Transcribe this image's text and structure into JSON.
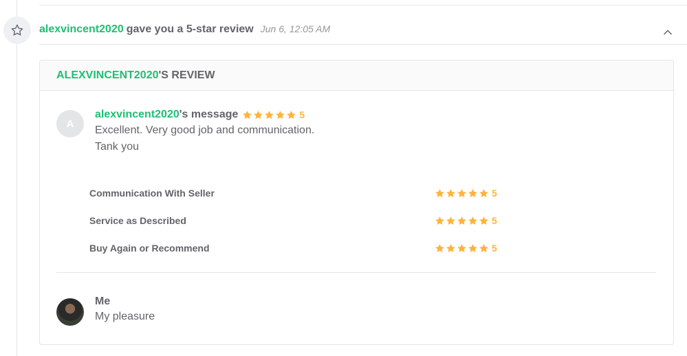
{
  "event": {
    "username": "alexvincent2020",
    "action_text": "gave you a 5-star review",
    "time": "Jun 6, 12:05 AM",
    "icon": "star-outline-icon",
    "collapse_icon": "chevron-up-icon"
  },
  "review": {
    "header_user": "ALEXVINCENT2020",
    "header_suffix": "'S REVIEW",
    "avatar_letter": "A",
    "message_user": "alexvincent2020",
    "message_suffix": "'s message",
    "overall_rating": "5",
    "message_text": "Excellent. Very good job and communication.\nTank you",
    "criteria": [
      {
        "label": "Communication With Seller",
        "rating": "5"
      },
      {
        "label": "Service as Described",
        "rating": "5"
      },
      {
        "label": "Buy Again or Recommend",
        "rating": "5"
      }
    ]
  },
  "reply": {
    "name": "Me",
    "text": "My pleasure"
  },
  "colors": {
    "brand_green": "#1dbf73",
    "star_yellow": "#ffb33e",
    "text_gray": "#62646a"
  }
}
